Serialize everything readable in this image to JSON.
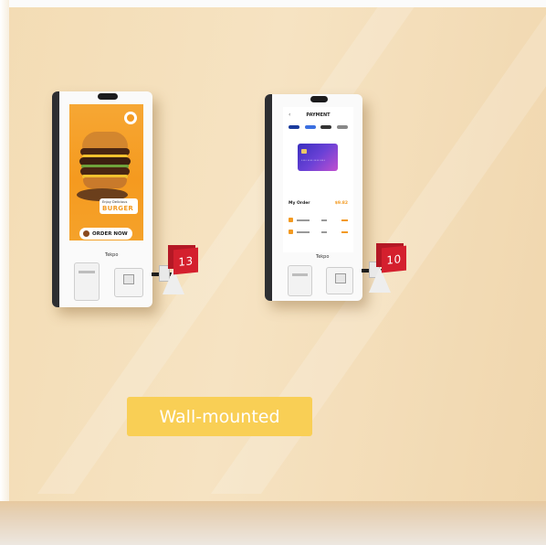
{
  "kiosk_left": {
    "brand": "Tekpo",
    "promo_small": "Enjoy Delicious",
    "promo_big": "BURGER",
    "order_button": "ORDER NOW",
    "table_number": "13"
  },
  "kiosk_right": {
    "brand": "Tekpo",
    "screen_title": "PAYMENT",
    "order_label": "My Order",
    "order_total": "$9.82",
    "table_number": "10"
  },
  "caption": {
    "label": "Wall-mounted",
    "bg_color": "#f9cf55",
    "text_color": "#ffffff"
  },
  "colors": {
    "wall": "#f3dcb4",
    "kiosk_body": "#fafafa",
    "accent_orange": "#f59a1f",
    "sign_red": "#d4202e",
    "card_purple": "#4a33c8"
  }
}
